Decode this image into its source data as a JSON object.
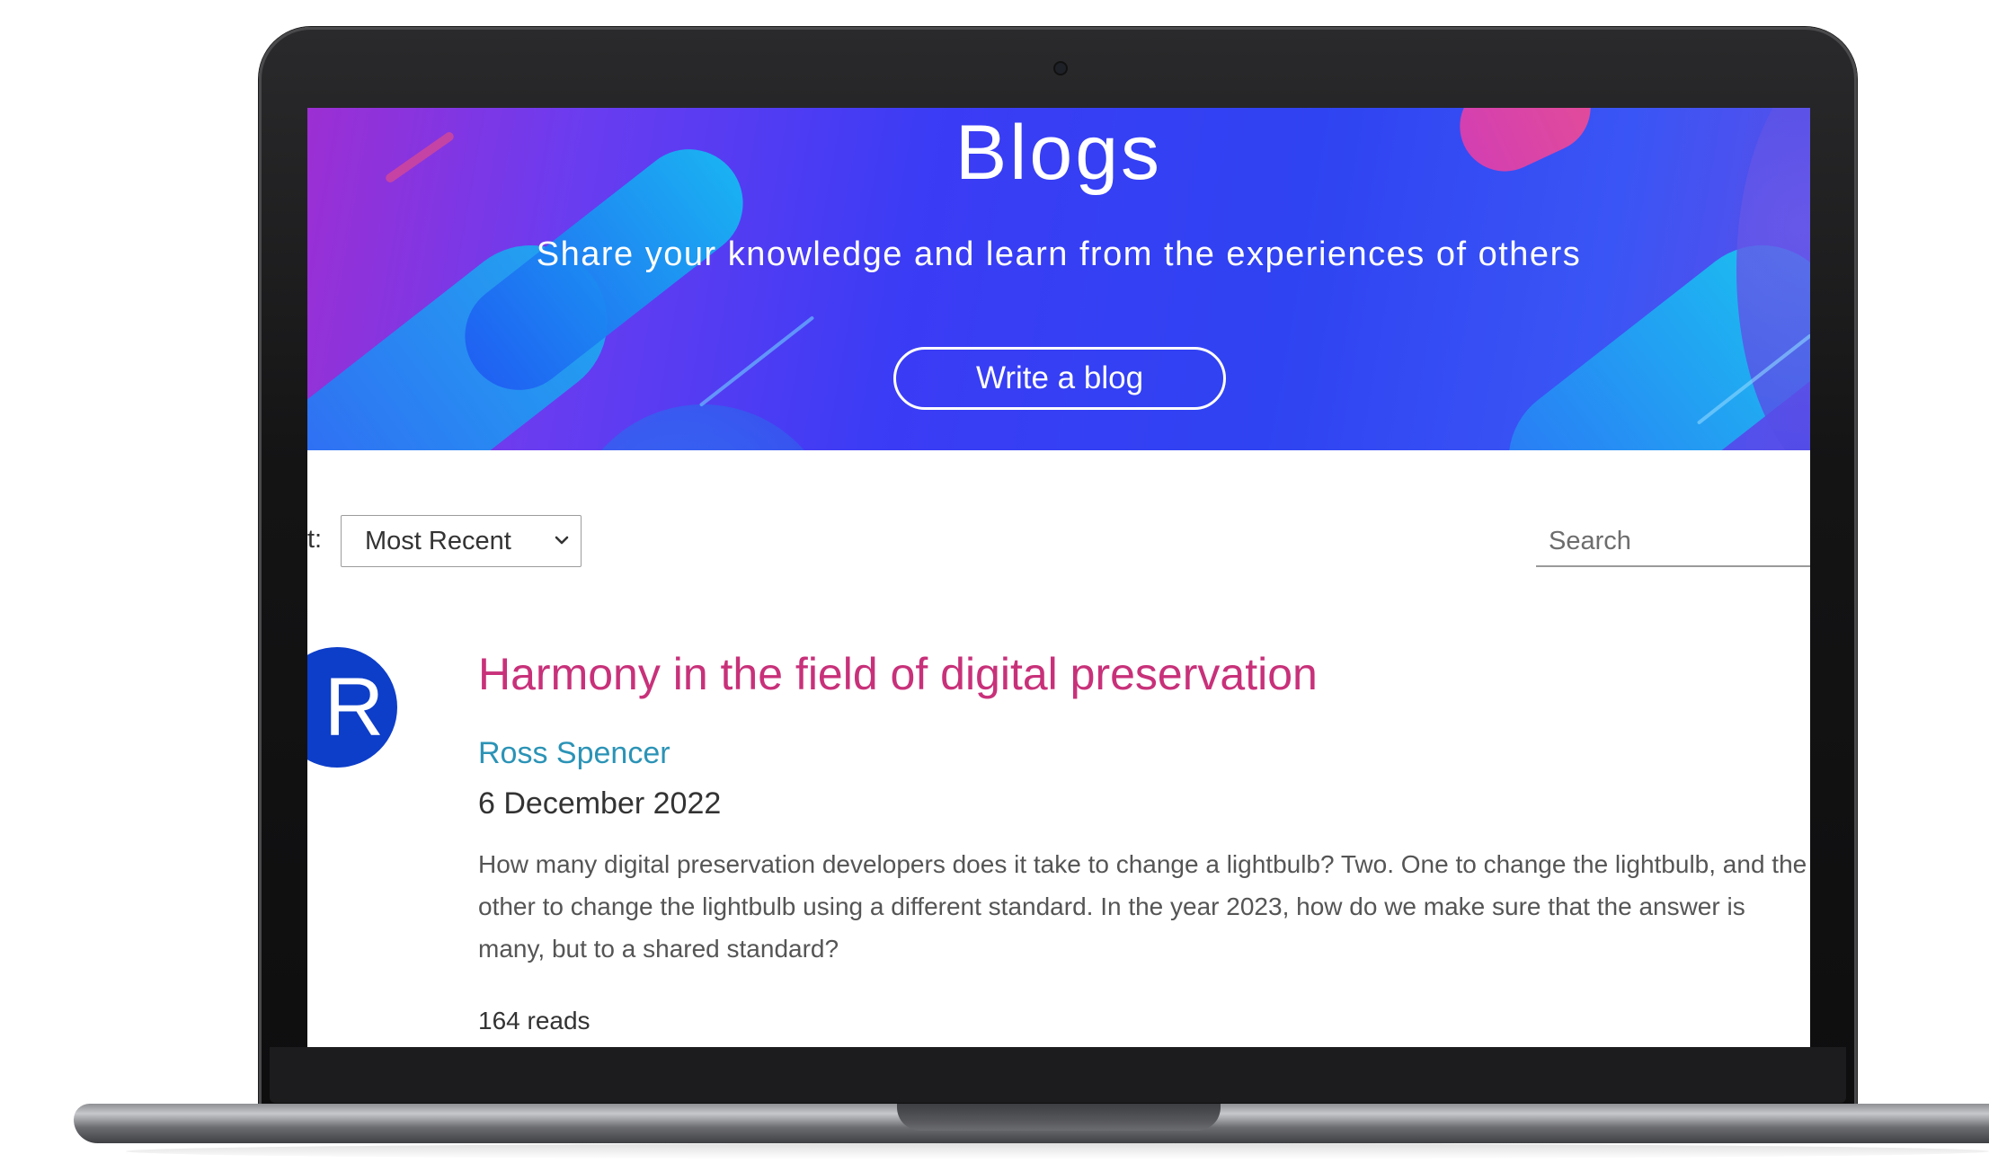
{
  "hero": {
    "title": "Blogs",
    "subtitle": "Share your knowledge and learn from the experiences of others",
    "write_button": "Write a blog"
  },
  "toolbar": {
    "sort_label": "t:",
    "sort_selected": "Most Recent",
    "search_placeholder": "Search"
  },
  "posts": [
    {
      "avatar_letter": "R",
      "title": "Harmony in the field of digital preservation",
      "author": "Ross Spencer",
      "date": "6 December 2022",
      "excerpt": "How many digital preservation developers does it take to change a lightbulb? Two. One to change the lightbulb, and the other to change the lightbulb using a different standard. In the year 2023, how do we make sure that the answer is many, but to a shared standard?",
      "reads": "164 reads"
    }
  ],
  "colors": {
    "title_accent": "#c8317a",
    "author_link": "#2b93b6",
    "avatar_bg": "#0d3ec9"
  },
  "icons": {
    "sort_dropdown": "chevron-down-icon"
  }
}
